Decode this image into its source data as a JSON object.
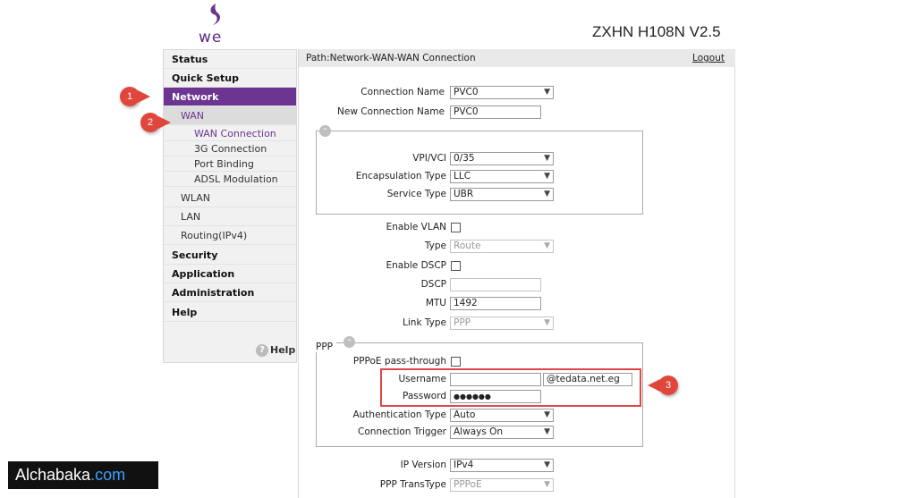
{
  "header": {
    "logo_text": "we",
    "model": "ZXHN H108N V2.5"
  },
  "sidebar": {
    "items": [
      {
        "label": "Status"
      },
      {
        "label": "Quick Setup"
      },
      {
        "label": "Network"
      },
      {
        "label": "WAN"
      },
      {
        "label": "WAN Connection"
      },
      {
        "label": "3G Connection"
      },
      {
        "label": "Port Binding"
      },
      {
        "label": "ADSL Modulation"
      },
      {
        "label": "WLAN"
      },
      {
        "label": "LAN"
      },
      {
        "label": "Routing(IPv4)"
      },
      {
        "label": "Security"
      },
      {
        "label": "Application"
      },
      {
        "label": "Administration"
      },
      {
        "label": "Help"
      }
    ],
    "help_link": "Help",
    "help_icon": "?"
  },
  "path": {
    "text": "Path:Network-WAN-WAN Connection",
    "logout": "Logout"
  },
  "form": {
    "connection_name": {
      "label": "Connection Name",
      "value": "PVC0"
    },
    "new_connection_name": {
      "label": "New Connection Name",
      "value": "PVC0"
    },
    "vpi_vci": {
      "label": "VPI/VCI",
      "value": "0/35"
    },
    "encapsulation": {
      "label": "Encapsulation Type",
      "value": "LLC"
    },
    "service_type": {
      "label": "Service Type",
      "value": "UBR"
    },
    "enable_vlan": {
      "label": "Enable VLAN"
    },
    "type": {
      "label": "Type",
      "value": "Route"
    },
    "enable_dscp": {
      "label": "Enable DSCP"
    },
    "dscp": {
      "label": "DSCP",
      "value": ""
    },
    "mtu": {
      "label": "MTU",
      "value": "1492"
    },
    "link_type": {
      "label": "Link Type",
      "value": "PPP"
    },
    "ppp_title": "PPP",
    "pppoe_passthrough": {
      "label": "PPPoE pass-through"
    },
    "username": {
      "label": "Username",
      "value": "",
      "suffix": "@tedata.net.eg"
    },
    "password": {
      "label": "Password",
      "value": "●●●●●●"
    },
    "auth_type": {
      "label": "Authentication Type",
      "value": "Auto"
    },
    "conn_trigger": {
      "label": "Connection Trigger",
      "value": "Always On"
    },
    "ip_version": {
      "label": "IP Version",
      "value": "IPv4"
    },
    "ppp_transtype": {
      "label": "PPP TransType",
      "value": "PPPoE"
    }
  },
  "markers": [
    "1",
    "2",
    "3"
  ],
  "watermark": {
    "name": "Alchabaka",
    "domain": ".com"
  },
  "colors": {
    "accent": "#6b3591",
    "marker": "#e0463c",
    "highlight": "#d94a4a"
  }
}
